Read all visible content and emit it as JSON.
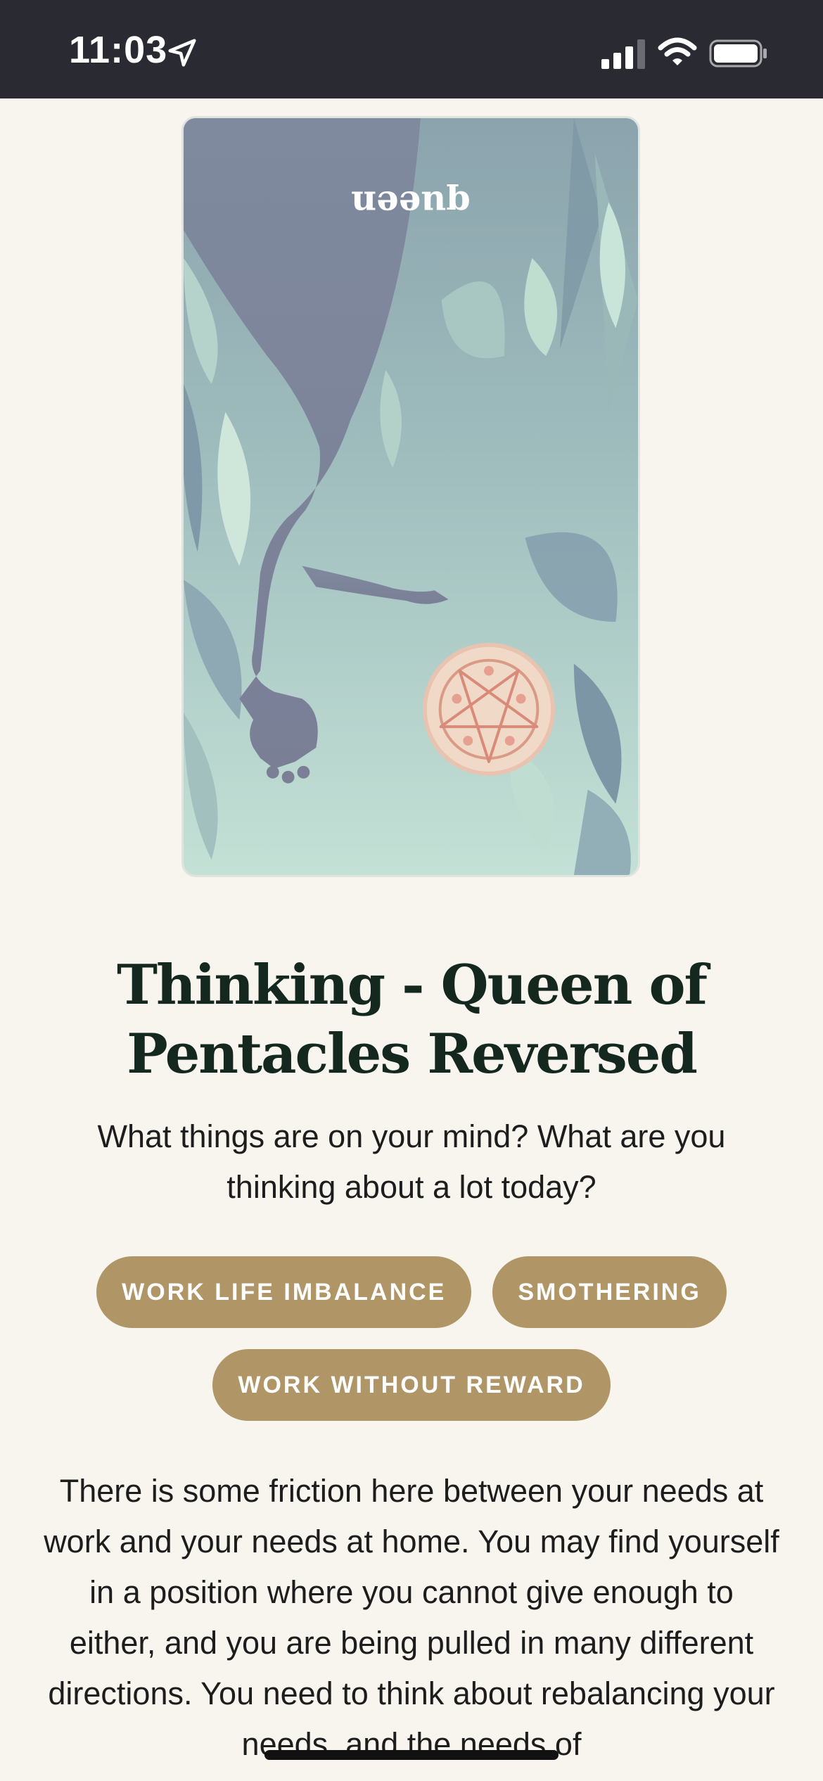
{
  "status_bar": {
    "time": "11:03"
  },
  "card": {
    "card_label": "queen"
  },
  "reading": {
    "title": "Thinking - Queen of Pentacles Reversed",
    "prompt": "What things are on your mind? What are you thinking about a lot today?",
    "tags": [
      "WORK LIFE IMBALANCE",
      "SMOTHERING",
      "WORK WITHOUT REWARD"
    ],
    "description": "There is some friction here between your needs at work and your needs at home. You may find yourself in a position where you cannot give enough to either, and you are being pulled in many different directions. You need to think about rebalancing your needs, and the needs of"
  },
  "colors": {
    "status_bar_bg": "#2a2a33",
    "page_bg": "#f8f5ee",
    "tag_bg": "#b09566",
    "title_color": "#14281f"
  },
  "icons": {
    "location": "location-arrow-icon",
    "signal": "cellular-signal-icon",
    "wifi": "wifi-icon",
    "battery": "battery-icon"
  }
}
